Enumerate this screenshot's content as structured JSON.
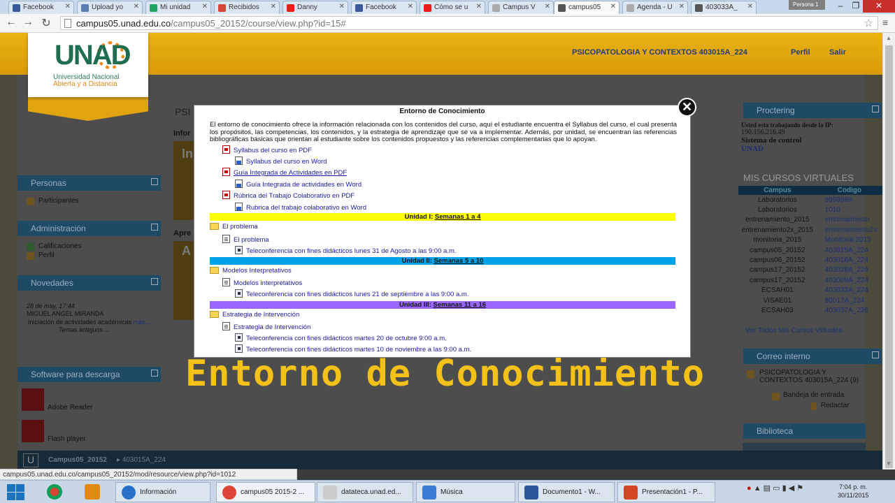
{
  "browser": {
    "tabs": [
      {
        "label": "Facebook",
        "color": "#3b5998"
      },
      {
        "label": "Upload yo",
        "color": "#5a7fb0"
      },
      {
        "label": "Mi unidad",
        "color": "#1fa463"
      },
      {
        "label": "Recibidos",
        "color": "#d44638"
      },
      {
        "label": "Danny",
        "color": "#e62117"
      },
      {
        "label": "Facebook",
        "color": "#3b5998"
      },
      {
        "label": "Cómo se u",
        "color": "#e62117"
      },
      {
        "label": "Campus V",
        "color": "#aaaaaa"
      },
      {
        "label": "campus05",
        "color": "#555555"
      },
      {
        "label": "Agenda - U",
        "color": "#aaaaaa"
      },
      {
        "label": "403033A_",
        "color": "#555555"
      }
    ],
    "profile": "Persona 1",
    "url_host": "campus05.unad.edu.co",
    "url_path": "/campus05_20152/course/view.php?id=15#",
    "status_url": "campus05.unad.edu.co/campus05_20152/mod/resource/view.php?id=1012"
  },
  "site": {
    "logo_text": "UNAD",
    "logo_line1": "Universidad Nacional",
    "logo_line2": "Abierta y a Distancia",
    "nav_course": "PSICOPATOLOGIA Y CONTEXTOS 403015A_224",
    "nav_profile": "Perfil",
    "nav_logout": "Salir",
    "course_heading": "PSI",
    "info_caption": "Infor",
    "learn_caption": "Apre",
    "thumb_letter1": "In",
    "thumb_letter2": "A"
  },
  "left_blocks": {
    "personas": {
      "title": "Personas",
      "items": [
        "Participantes"
      ]
    },
    "admin": {
      "title": "Administración",
      "items": [
        "Calificaciones",
        "Perfil"
      ]
    },
    "news": {
      "title": "Novedades",
      "date": "28 de may, 17:44",
      "author": "MIGUEL ANGEL MIRANDA",
      "text": "Iniciación de actividades académicas",
      "more": "más...",
      "old": "Temas antiguos ..."
    },
    "software": {
      "title": "Software para descarga",
      "items": [
        "Adobe Reader",
        "Flash player"
      ]
    }
  },
  "right_blocks": {
    "proctoring_title": "Proctering",
    "ip_line": "Usted esta trabajando desde la IP:",
    "ip": "190.156.216.49",
    "control": "Sistema de control",
    "control_brand": "UNAD",
    "courses_title": "MIS CURSOS VIRTUALES",
    "courses_headers": [
      "Campus",
      "Codigo"
    ],
    "courses": [
      [
        "Laboratorios",
        "9999999"
      ],
      [
        "Laboratorios",
        "1010"
      ],
      [
        "entrenamiento_2015",
        "entrenamiento"
      ],
      [
        "entrenamiento2x_2015",
        "entrenamiento2x"
      ],
      [
        "monitoria_2015",
        "Monitoria 2015"
      ],
      [
        "campus05_20152",
        "403015A_224"
      ],
      [
        "campus06_20152",
        "403016A_224"
      ],
      [
        "campus17_20152",
        "403028A_224"
      ],
      [
        "campus17_20152",
        "403009A_224"
      ],
      [
        "ECSAH01",
        "403033A_224"
      ],
      [
        "VISAE01",
        "80017A_224"
      ],
      [
        "ECSAH03",
        "403037A_226"
      ]
    ],
    "all_courses": "Ver Todos Mis Cursos Virtuales",
    "mail_title": "Correo interno",
    "mail_course": "PSICOPATOLOGIA Y CONTEXTOS 403015A_224 (9)",
    "inbox": "Bandeja de entrada",
    "compose": "Redactar",
    "library_title": "Biblioteca"
  },
  "modal": {
    "title": "Entorno de Conocimiento",
    "intro": "El entorno de conocimiento ofrece la información relacionada con los contenidos del curso, aquí el estudiante encuentra el Syllabus del curso, el cual presenta los propósitos, las competencias, los contenidos, y la estrategia de aprendizaje que se va a implementar. Además, por unidad, se encuentran las referencias bibliográficas básicas que orientan al estudiante sobre los contenidos propuestos y las referencias complementarias que lo apoyan.",
    "docs": [
      "Syllabus del curso en PDF",
      "Syllabus del curso en Word",
      "Guía Integrada de Actividades en PDF",
      "Guía Integrada de actividades en Word",
      "Rúbrica del Trabajo Colaborativo en PDF",
      "Rubrica del trabajo colaborativo en Word"
    ],
    "units": [
      {
        "label": "Unidad I:",
        "weeks": "Semanas 1 a 4",
        "color": "#ffff00",
        "folder": "El problema",
        "page": "El problema",
        "sessions": [
          "Teleconferencia con fines didácticos lunes 31 de Agosto a las 9:00 a.m."
        ]
      },
      {
        "label": "Unidad II:",
        "weeks": "Semanas 5 a 10",
        "color": "#00a2e8",
        "folder": "Modelos Interpretativos",
        "page": "Modelos interpretativos",
        "sessions": [
          "Teleconferencia con fines didácticos lunes 21 de septiembre a las 9:00 a.m."
        ]
      },
      {
        "label": "Unidad III:",
        "weeks": "Semanas 11 a 16",
        "color": "#9966ff",
        "folder": "Estrategia de Intervención",
        "page": "Estrategia de Intervención",
        "sessions": [
          "Teleconferencia con fines didácticos martes 20 de octubre 9:00 a.m.",
          "Teleconferencia con fines didácticos martes 10 de noviembre a las 9:00 a.m."
        ]
      }
    ]
  },
  "promo_title": "Entorno de Conocimiento",
  "footer": {
    "course": "Campus05_20152",
    "code": "403015A_224"
  },
  "taskbar": {
    "items": [
      "Información",
      "campus05 2015-2 ...",
      "datateca.unad.ed...",
      "Música",
      "Documento1 - W...",
      "Presentación1 - P..."
    ],
    "time": "7:04 p. m.",
    "date": "30/11/2015"
  }
}
